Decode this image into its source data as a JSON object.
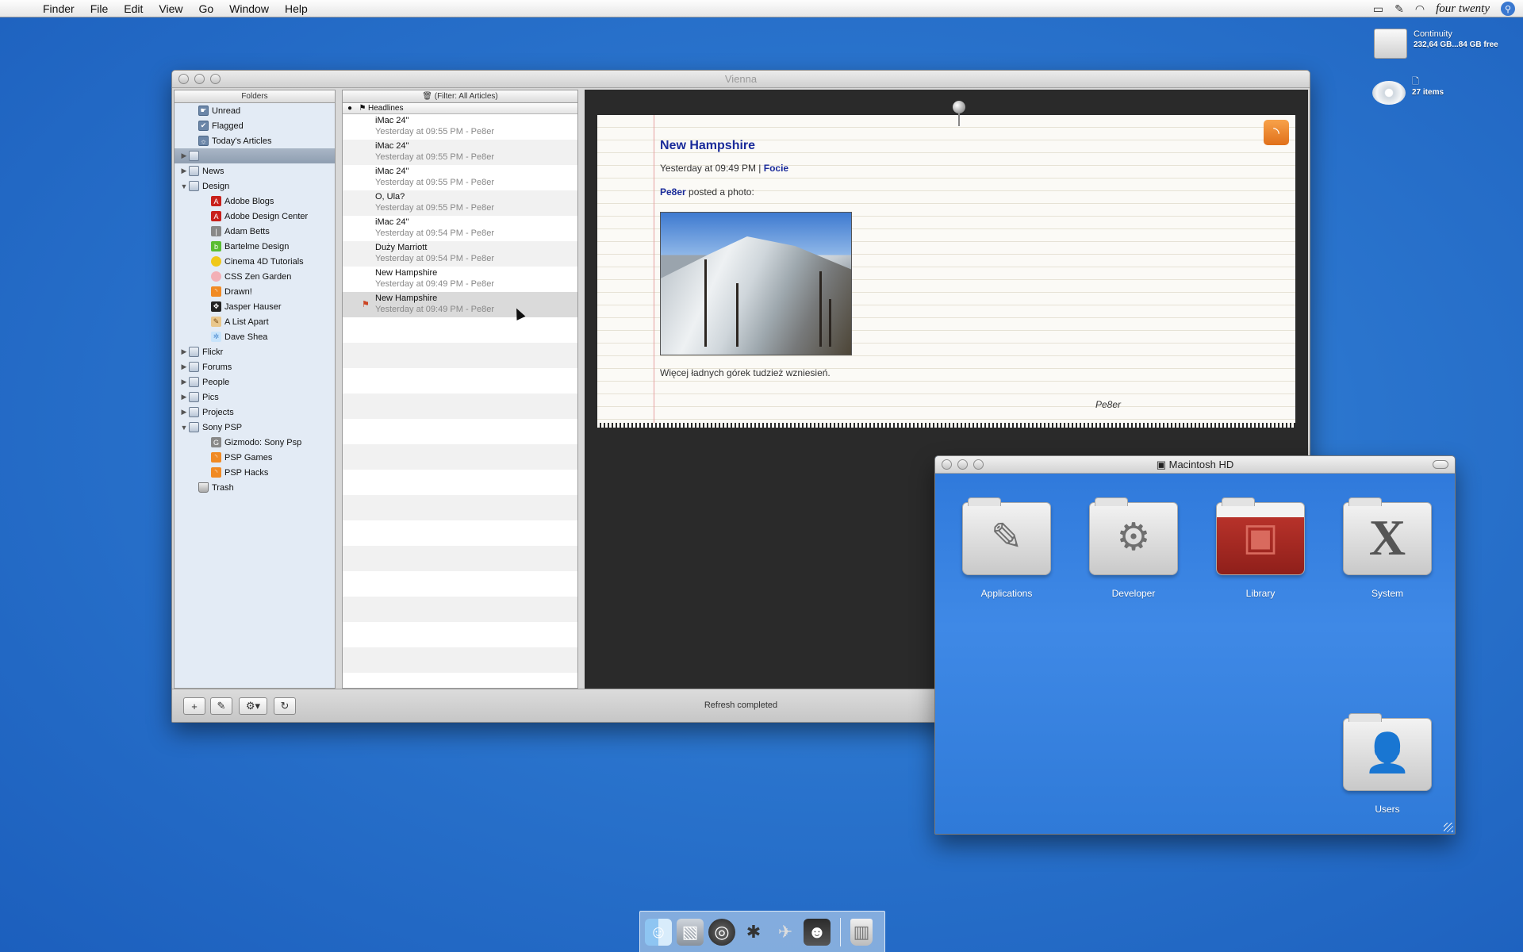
{
  "menubar": {
    "apple_icon": "apple-icon",
    "app_name": "Finder",
    "menus": [
      "File",
      "Edit",
      "View",
      "Go",
      "Window",
      "Help"
    ],
    "clock": "four twenty"
  },
  "desktop": {
    "drive": {
      "name": "Continuity",
      "info": "232,64 GB...84 GB free"
    },
    "disc": {
      "name": "🗋",
      "info": "27 items"
    }
  },
  "vienna": {
    "title": "Vienna",
    "folders_header": "Folders",
    "folders": [
      {
        "label": "Unread",
        "icon": "smart",
        "glyph": "☛",
        "tri": "",
        "indent": 1
      },
      {
        "label": "Flagged",
        "icon": "smart",
        "glyph": "✔",
        "tri": "",
        "indent": 1
      },
      {
        "label": "Today's Articles",
        "icon": "smart",
        "glyph": "☼",
        "tri": "",
        "indent": 1
      },
      {
        "label": "",
        "icon": "group",
        "glyph": "",
        "tri": "▶",
        "indent": 0,
        "selected": true
      },
      {
        "label": "News",
        "icon": "group",
        "glyph": "",
        "tri": "▶",
        "indent": 0
      },
      {
        "label": "Design",
        "icon": "group",
        "glyph": "",
        "tri": "▼",
        "indent": 0
      },
      {
        "label": "Adobe Blogs",
        "icon": "red",
        "glyph": "A",
        "tri": "",
        "indent": 2
      },
      {
        "label": "Adobe Design Center",
        "icon": "red",
        "glyph": "A",
        "tri": "",
        "indent": 2
      },
      {
        "label": "Adam Betts",
        "icon": "gray",
        "glyph": "|",
        "tri": "",
        "indent": 2
      },
      {
        "label": "Bartelme Design",
        "icon": "green",
        "glyph": "b",
        "tri": "",
        "indent": 2
      },
      {
        "label": "Cinema 4D Tutorials",
        "icon": "yellow",
        "glyph": "",
        "tri": "",
        "indent": 2
      },
      {
        "label": "CSS Zen Garden",
        "icon": "pink",
        "glyph": "",
        "tri": "",
        "indent": 2
      },
      {
        "label": "Drawn!",
        "icon": "feed",
        "glyph": "◝",
        "tri": "",
        "indent": 2
      },
      {
        "label": "Jasper Hauser",
        "icon": "dark",
        "glyph": "✥",
        "tri": "",
        "indent": 2
      },
      {
        "label": "A List Apart",
        "icon": "tan",
        "glyph": "✎",
        "tri": "",
        "indent": 2
      },
      {
        "label": "Dave Shea",
        "icon": "light",
        "glyph": "✲",
        "tri": "",
        "indent": 2
      },
      {
        "label": "Flickr",
        "icon": "group",
        "glyph": "",
        "tri": "▶",
        "indent": 0
      },
      {
        "label": "Forums",
        "icon": "group",
        "glyph": "",
        "tri": "▶",
        "indent": 0
      },
      {
        "label": "People",
        "icon": "group",
        "glyph": "",
        "tri": "▶",
        "indent": 0
      },
      {
        "label": "Pics",
        "icon": "group",
        "glyph": "",
        "tri": "▶",
        "indent": 0
      },
      {
        "label": "Projects",
        "icon": "group",
        "glyph": "",
        "tri": "▶",
        "indent": 0
      },
      {
        "label": "Sony PSP",
        "icon": "group",
        "glyph": "",
        "tri": "▼",
        "indent": 0
      },
      {
        "label": "Gizmodo: Sony Psp",
        "icon": "gray",
        "glyph": "G",
        "tri": "",
        "indent": 2
      },
      {
        "label": "PSP Games",
        "icon": "feed",
        "glyph": "◝",
        "tri": "",
        "indent": 2
      },
      {
        "label": "PSP Hacks",
        "icon": "feed",
        "glyph": "◝",
        "tri": "",
        "indent": 2
      },
      {
        "label": "Trash",
        "icon": "trash",
        "glyph": "",
        "tri": "",
        "indent": 1
      }
    ],
    "filter_label": "(Filter: All Articles)",
    "headlines_label": "Headlines",
    "articles": [
      {
        "title": "iMac 24\"",
        "meta": "Yesterday at 09:55 PM - Pe8er"
      },
      {
        "title": "iMac 24\"",
        "meta": "Yesterday at 09:55 PM - Pe8er"
      },
      {
        "title": "iMac 24\"",
        "meta": "Yesterday at 09:55 PM - Pe8er"
      },
      {
        "title": "O, Ula?",
        "meta": "Yesterday at 09:55 PM - Pe8er"
      },
      {
        "title": "iMac 24\"",
        "meta": "Yesterday at 09:54 PM - Pe8er"
      },
      {
        "title": "Duży Marriott",
        "meta": "Yesterday at 09:54 PM - Pe8er"
      },
      {
        "title": "New Hampshire",
        "meta": "Yesterday at 09:49 PM - Pe8er"
      },
      {
        "title": "New Hampshire",
        "meta": "Yesterday at 09:49 PM - Pe8er",
        "selected": true,
        "flagged": true
      }
    ],
    "reader": {
      "title": "New Hampshire",
      "date": "Yesterday at 09:49 PM |",
      "category": "Focie",
      "author": "Pe8er",
      "posted_text": "posted a photo:",
      "caption": "Więcej ładnych górek tudzież wzniesień.",
      "signature": "Pe8er"
    },
    "status": "Refresh completed"
  },
  "finder_window": {
    "title": "Macintosh HD",
    "items": [
      {
        "label": "Applications",
        "emblem": "✎"
      },
      {
        "label": "Developer",
        "emblem": "⚙"
      },
      {
        "label": "Library",
        "emblem": "▣"
      },
      {
        "label": "System",
        "emblem": "X"
      },
      {
        "label": "Users",
        "emblem": "👤"
      }
    ]
  },
  "dock": {
    "items": [
      "finder-icon",
      "preview-icon",
      "dvd-player-icon",
      "system-prefs-icon",
      "xcode-icon",
      "photo-booth-icon"
    ],
    "trash": "trash-icon"
  }
}
